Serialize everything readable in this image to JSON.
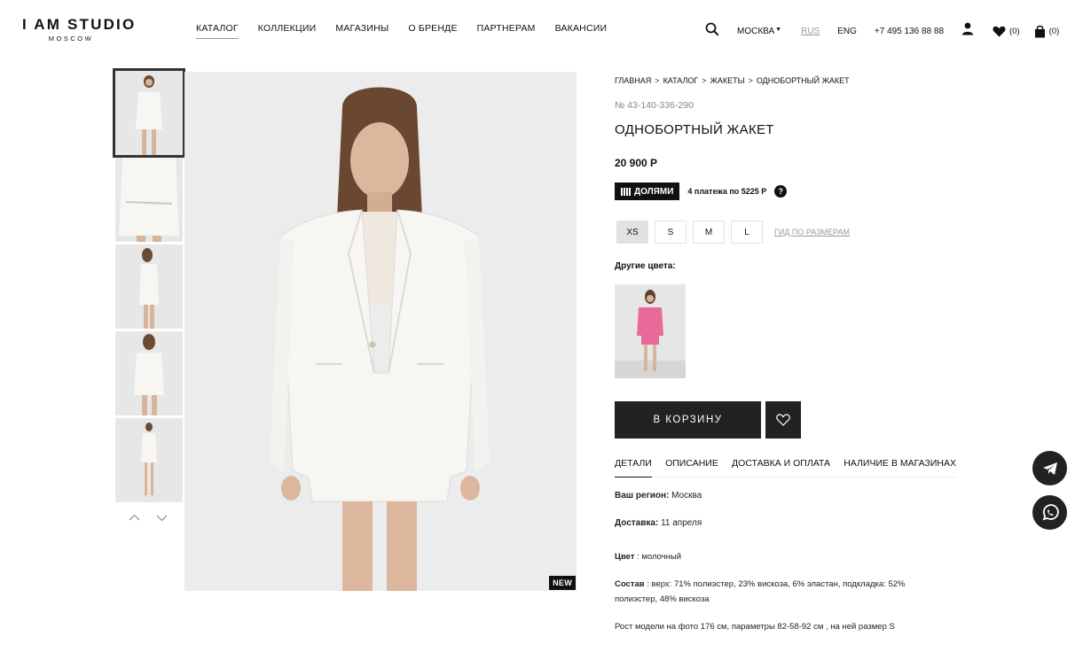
{
  "brand": {
    "name": "I AM STUDIO",
    "subtitle": "MOSCOW"
  },
  "nav": [
    {
      "label": "КАТАЛОГ",
      "active": true
    },
    {
      "label": "КОЛЛЕКЦИИ"
    },
    {
      "label": "МАГАЗИНЫ"
    },
    {
      "label": "О БРЕНДЕ"
    },
    {
      "label": "ПАРТНЕРАМ"
    },
    {
      "label": "ВАКАНСИИ"
    }
  ],
  "header": {
    "search_icon": "search-icon",
    "city": "МОСКВА",
    "lang_rus": "RUS",
    "lang_eng": "ENG",
    "phone": "+7 495 136 88 88",
    "account_icon": "user-icon",
    "favorites_count": "(0)",
    "cart_count": "(0)"
  },
  "gallery": {
    "thumbnails": [
      "thumb-front",
      "thumb-back",
      "thumb-side",
      "thumb-back-2",
      "thumb-full"
    ],
    "badge": "NEW"
  },
  "product": {
    "breadcrumbs": [
      "ГЛАВНАЯ",
      "КАТАЛОГ",
      "ЖАКЕТЫ",
      "ОДНОБОРТНЫЙ ЖАКЕТ"
    ],
    "sku": "№ 43-140-336-290",
    "title": "ОДНОБОРТНЫЙ ЖАКЕТ",
    "price": "20 900 Р",
    "dolyami_label": "ДОЛЯМИ",
    "installments": "4 платежа по 5225 Р",
    "help_mark": "?",
    "sizes": [
      {
        "label": "XS",
        "selected": true
      },
      {
        "label": "S"
      },
      {
        "label": "M"
      },
      {
        "label": "L"
      }
    ],
    "size_guide": "ГИД ПО РАЗМЕРАМ",
    "other_colors_label": "Другие цвета:",
    "add_to_cart": "В КОРЗИНУ"
  },
  "tabs": [
    {
      "label": "ДЕТАЛИ",
      "active": true
    },
    {
      "label": "ОПИСАНИЕ"
    },
    {
      "label": "ДОСТАВКА И ОПЛАТА"
    },
    {
      "label": "НАЛИЧИЕ В МАГАЗИНАХ"
    }
  ],
  "details": {
    "region_label": "Ваш регион:",
    "region_value": "Москва",
    "delivery_label": "Доставка:",
    "delivery_value": "11 апреля",
    "color_label": "Цвет",
    "color_value": ": молочный",
    "composition_label": "Состав",
    "composition_value": ": верх: 71% полиэстер, 23% вискоза, 6% эластан, подкладка: 52%",
    "composition_value_2": "полиэстер, 48% вискоза",
    "model_info": "Рост модели на фото 176 см, параметры 82-58-92 см , на ней размер S"
  },
  "colors": {
    "accent": "#111111",
    "muted": "#999999",
    "jacket_white": "#f6f5f1",
    "swatch_pink": "#e86a98"
  }
}
